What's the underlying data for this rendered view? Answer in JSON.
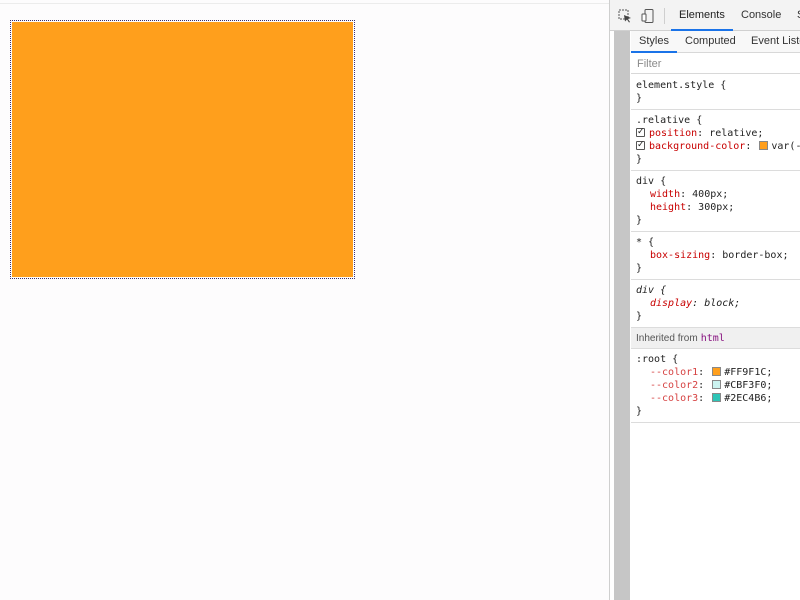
{
  "devtools": {
    "tabs": [
      "Elements",
      "Console",
      "S"
    ],
    "sub_tabs": [
      "Styles",
      "Computed",
      "Event Listeners"
    ],
    "filter_placeholder": "Filter",
    "element_style": {
      "selector": "element.style {",
      "close": "}"
    },
    "relative_rule": {
      "selector": ".relative {",
      "p1": "position",
      "v1": "relative;",
      "p2": "background-color",
      "v2": "var(--",
      "close": "}"
    },
    "div_rule": {
      "selector": "div {",
      "p1": "width",
      "v1": "400px;",
      "p2": "height",
      "v2": "300px;",
      "close": "}"
    },
    "star_rule": {
      "selector": "* {",
      "p1": "box-sizing",
      "v1": "border-box;",
      "close": "}"
    },
    "ua_div_rule": {
      "selector": "div {",
      "p1": "display",
      "v1": "block;",
      "close": "}"
    },
    "inherited": {
      "label": "Inherited from",
      "tag": "html"
    },
    "root_rule": {
      "selector": ":root {",
      "vars": [
        {
          "name": "--color1",
          "value": "#FF9F1C;",
          "swatch": "#FF9F1C"
        },
        {
          "name": "--color2",
          "value": "#CBF3F0;",
          "swatch": "#CBF3F0"
        },
        {
          "name": "--color3",
          "value": "#2EC4B6;",
          "swatch": "#2EC4B6"
        }
      ],
      "close": "}"
    }
  },
  "colors": {
    "box_fill": "#FF9F1C",
    "accent": "#1a73e8"
  },
  "icons": [
    "inspect-element-icon",
    "device-toolbar-icon"
  ]
}
